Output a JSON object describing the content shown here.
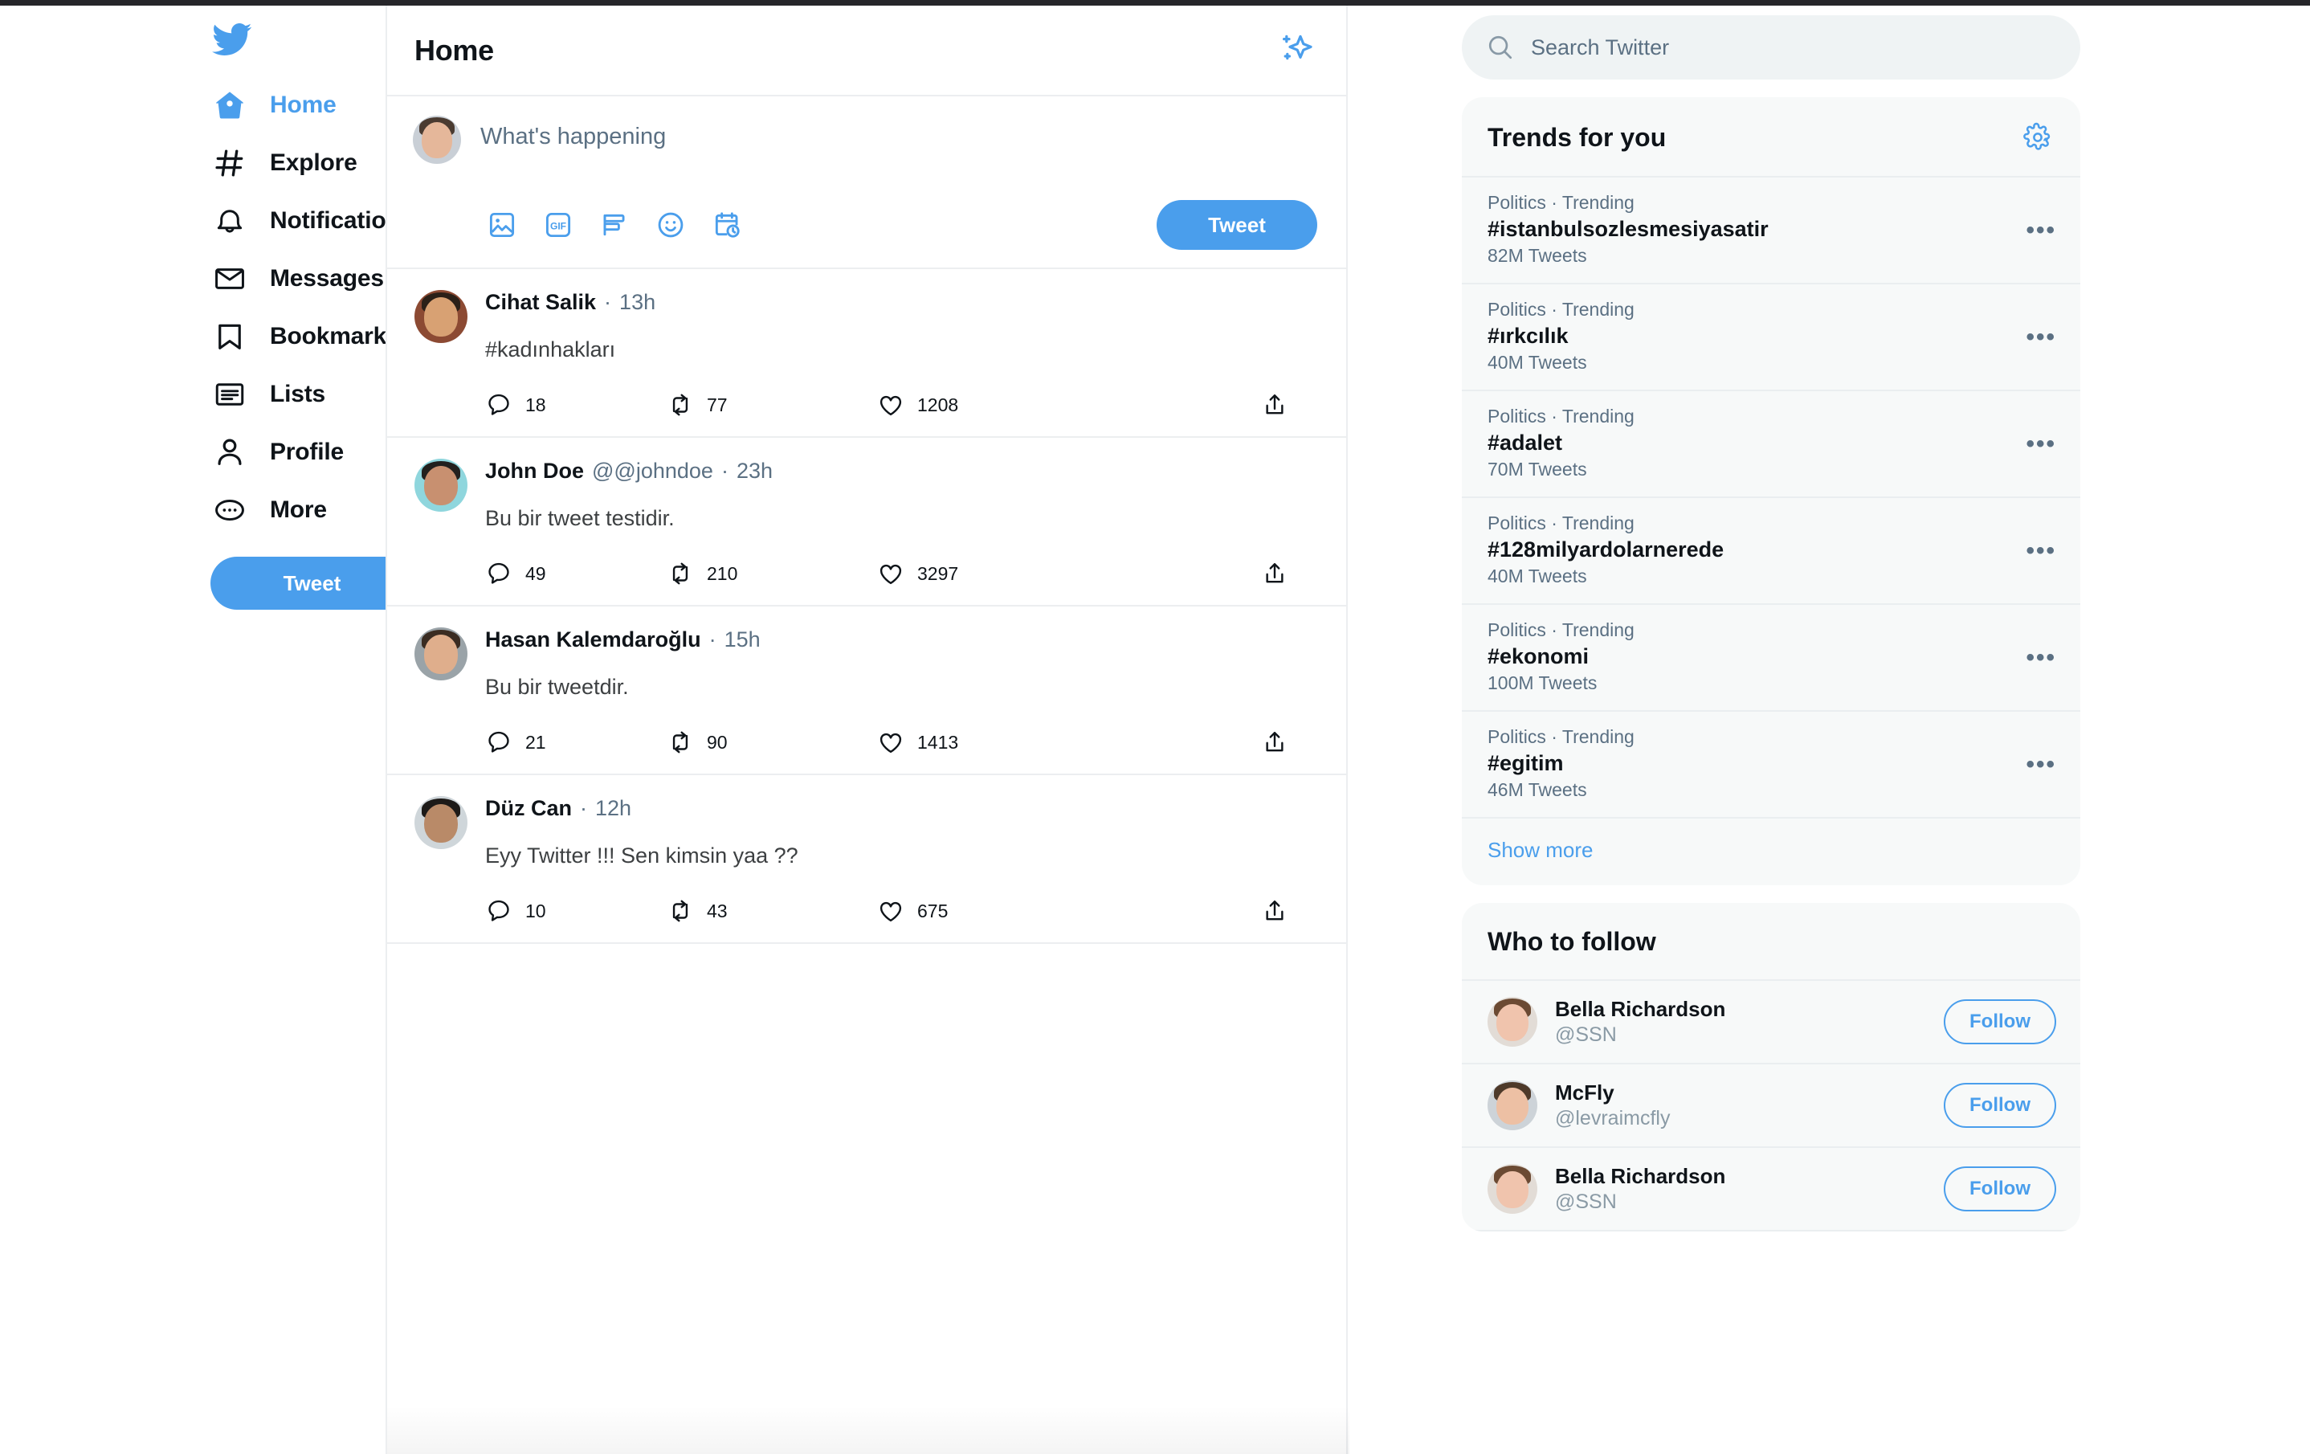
{
  "sidebar": {
    "logo_icon": "twitter-bird-icon",
    "items": [
      {
        "label": "Home",
        "icon": "home-icon",
        "active": true
      },
      {
        "label": "Explore",
        "icon": "hashtag-icon",
        "active": false
      },
      {
        "label": "Notifications",
        "icon": "bell-icon",
        "active": false
      },
      {
        "label": "Messages",
        "icon": "envelope-icon",
        "active": false
      },
      {
        "label": "Bookmarks",
        "icon": "bookmark-icon",
        "active": false
      },
      {
        "label": "Lists",
        "icon": "list-icon",
        "active": false
      },
      {
        "label": "Profile",
        "icon": "person-icon",
        "active": false
      },
      {
        "label": "More",
        "icon": "ellipsis-circle-icon",
        "active": false
      }
    ],
    "tweet_button": "Tweet"
  },
  "main": {
    "title": "Home",
    "sparkle_icon": "sparkles-icon",
    "composer": {
      "placeholder": "What's happening",
      "tweet_button": "Tweet",
      "icons": [
        "image-icon",
        "gif-icon",
        "poll-icon",
        "emoji-icon",
        "schedule-icon"
      ]
    },
    "tweets": [
      {
        "name": "Cihat Salik",
        "handle": "",
        "time": "13h",
        "text": "#kadınhakları",
        "replies": "18",
        "retweets": "77",
        "likes": "1208"
      },
      {
        "name": "John Doe",
        "handle": "@@johndoe",
        "time": "23h",
        "text": "Bu bir tweet testidir.",
        "replies": "49",
        "retweets": "210",
        "likes": "3297"
      },
      {
        "name": "Hasan Kalemdaroğlu",
        "handle": "",
        "time": "15h",
        "text": "Bu bir tweetdir.",
        "replies": "21",
        "retweets": "90",
        "likes": "1413"
      },
      {
        "name": "Düz Can",
        "handle": "",
        "time": "12h",
        "text": "Eyy Twitter !!! Sen kimsin yaa ??",
        "replies": "10",
        "retweets": "43",
        "likes": "675"
      }
    ]
  },
  "right": {
    "search": {
      "placeholder": "Search Twitter",
      "icon": "search-icon"
    },
    "trends": {
      "title": "Trends for you",
      "settings_icon": "gear-icon",
      "show_more": "Show more",
      "items": [
        {
          "category": "Politics · Trending",
          "tag": "#istanbulsozlesmesiyasatir",
          "count": "82M Tweets"
        },
        {
          "category": "Politics · Trending",
          "tag": "#ırkcılık",
          "count": "40M Tweets"
        },
        {
          "category": "Politics · Trending",
          "tag": "#adalet",
          "count": "70M Tweets"
        },
        {
          "category": "Politics · Trending",
          "tag": "#128milyardolarnerede",
          "count": "40M Tweets"
        },
        {
          "category": "Politics · Trending",
          "tag": "#ekonomi",
          "count": "100M Tweets"
        },
        {
          "category": "Politics · Trending",
          "tag": "#egitim",
          "count": "46M Tweets"
        }
      ]
    },
    "who_to_follow": {
      "title": "Who to follow",
      "items": [
        {
          "name": "Bella Richardson",
          "handle": "@SSN",
          "button": "Follow"
        },
        {
          "name": "McFly",
          "handle": "@levraimcfly",
          "button": "Follow"
        },
        {
          "name": "Bella Richardson",
          "handle": "@SSN",
          "button": "Follow"
        }
      ]
    }
  },
  "colors": {
    "accent": "#4a9eec",
    "text_primary": "#0f1419",
    "text_muted": "#5b7083",
    "border": "#eceef0",
    "card_bg": "#f7f9f9",
    "search_bg": "#eff3f4"
  }
}
